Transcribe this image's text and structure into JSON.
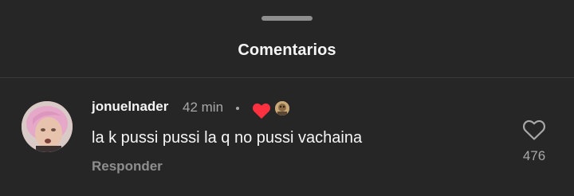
{
  "sheet": {
    "title": "Comentarios"
  },
  "comment": {
    "username": "jonuelnader",
    "time": "42 min",
    "text": "la k pussi pussi la q no pussi vachaina",
    "reply_label": "Responder",
    "like_count": "476",
    "liked_by_author": true,
    "avatar_icon": "user-avatar-photo",
    "heart_icon": "heart-filled-icon",
    "like_icon": "heart-outline-icon"
  },
  "colors": {
    "background": "#262626",
    "primary_text": "#f5f5f5",
    "secondary_text": "#a8a8a8",
    "muted_text": "#8e8e8e",
    "heart_red": "#ff3040",
    "divider": "#3a3a3a"
  }
}
